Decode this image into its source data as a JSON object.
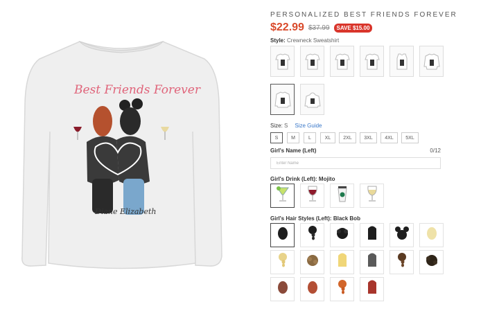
{
  "product": {
    "title": "PERSONALIZED BEST FRIENDS FOREVER",
    "price": "$22.99",
    "old_price": "$37.99",
    "save_badge": "SAVE $15.00"
  },
  "hero_image": {
    "design_title": "Best Friends Forever",
    "name_left": "Diane",
    "name_right": "Elizabeth"
  },
  "style": {
    "label": "Style:",
    "value": "Crewneck Sweatshirt",
    "options": [
      "Crewneck Sweatshirt"
    ],
    "selected_index": 6
  },
  "size": {
    "label": "Size:",
    "value": "S",
    "guide_label": "Size Guide",
    "options": [
      "S",
      "M",
      "L",
      "XL",
      "2XL",
      "3XL",
      "4XL",
      "5XL"
    ],
    "selected": "S"
  },
  "girl_name": {
    "label": "Girl's Name (Left)",
    "counter": "0/12",
    "placeholder": "Enter Name"
  },
  "drink": {
    "label": "Girl's Drink (Left):",
    "value": "Mojito",
    "options": [
      "mojito-icon",
      "red-wine-icon",
      "coffee-cup-icon",
      "white-wine-icon"
    ],
    "selected_index": 0
  },
  "hair": {
    "label": "Girl's Hair Styles (Left):",
    "value": "Black Bob",
    "selected_index": 0
  },
  "colors": {
    "price": "#d94a2b",
    "save_badge": "#d9352b",
    "link": "#3a78c9",
    "title_script": "#e0647a"
  }
}
